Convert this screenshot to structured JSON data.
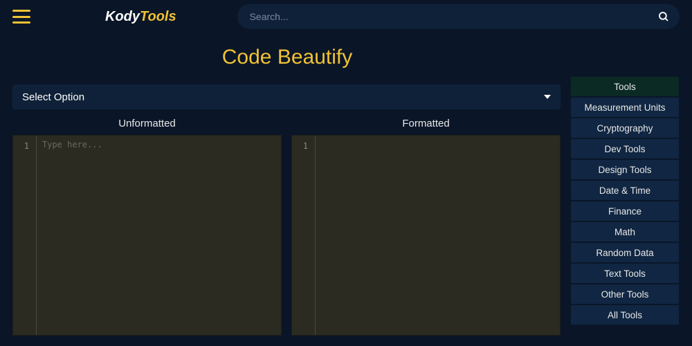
{
  "brand": {
    "first": "Kody",
    "second": "Tools"
  },
  "search": {
    "placeholder": "Search..."
  },
  "pageTitle": "Code Beautify",
  "select": {
    "label": "Select Option"
  },
  "panes": {
    "left": {
      "label": "Unformatted",
      "lineNumber": "1",
      "placeholder": "Type here..."
    },
    "right": {
      "label": "Formatted",
      "lineNumber": "1"
    }
  },
  "sidebar": {
    "items": [
      "Tools",
      "Measurement Units",
      "Cryptography",
      "Dev Tools",
      "Design Tools",
      "Date & Time",
      "Finance",
      "Math",
      "Random Data",
      "Text Tools",
      "Other Tools",
      "All Tools"
    ],
    "activeIndex": 0
  }
}
